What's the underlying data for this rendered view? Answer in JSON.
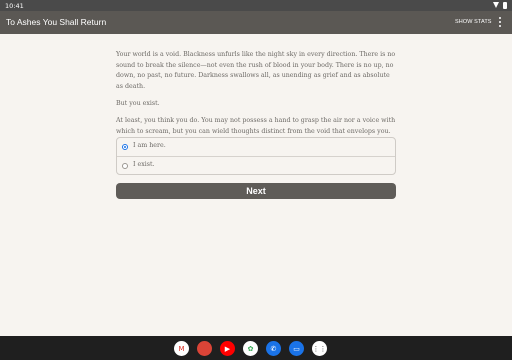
{
  "status": {
    "time": "10:41"
  },
  "app": {
    "title": "To Ashes You Shall Return",
    "show_stats": "SHOW STATS"
  },
  "story": {
    "paragraphs": [
      "Your world is a void. Blackness unfurls like the night sky in every direction. There is no sound to break the silence—not even the rush of blood in your body. There is no up, no down, no past, no future. Darkness swallows all, as unending as grief and as absolute as death.",
      "But you exist.",
      "At least, you think you do. You may not possess a hand to grasp the air nor a voice with which to scream, but you can wield thoughts distinct from the void that envelops you."
    ]
  },
  "choices": [
    {
      "label": "I am here.",
      "selected": true
    },
    {
      "label": "I exist.",
      "selected": false
    }
  ],
  "next_label": "Next",
  "dock": [
    {
      "icon": "gmail-icon",
      "glyph": "M",
      "color": "#ffffff",
      "fg": "#d93025"
    },
    {
      "icon": "chrome-icon",
      "glyph": "",
      "color": "#db4437",
      "fg": "#ffffff"
    },
    {
      "icon": "youtube-icon",
      "glyph": "▶",
      "color": "#ff0000",
      "fg": "#ffffff"
    },
    {
      "icon": "photos-icon",
      "glyph": "✿",
      "color": "#ffffff",
      "fg": "#34a853"
    },
    {
      "icon": "phone-icon",
      "glyph": "✆",
      "color": "#1a73e8",
      "fg": "#ffffff"
    },
    {
      "icon": "messages-icon",
      "glyph": "▭",
      "color": "#1a73e8",
      "fg": "#ffffff"
    },
    {
      "icon": "app-drawer-icon",
      "glyph": "⋮⋮",
      "color": "#ffffff",
      "fg": "#333333"
    }
  ]
}
